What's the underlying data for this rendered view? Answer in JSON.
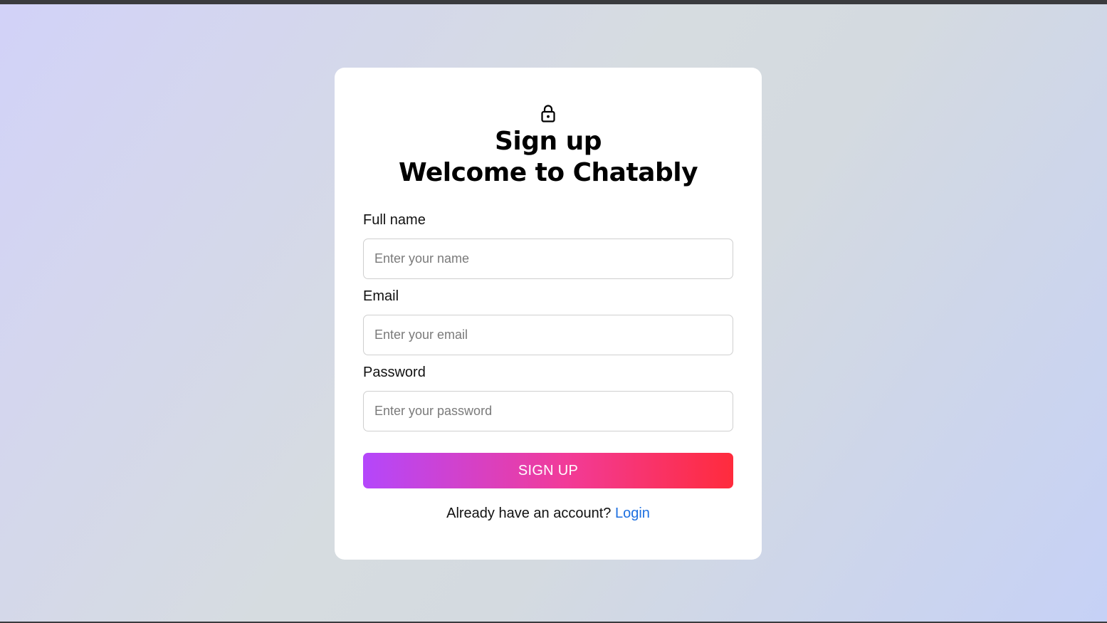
{
  "signup": {
    "icon": "lock-icon",
    "title": "Sign up",
    "subtitle": "Welcome to Chatably",
    "fields": [
      {
        "label": "Full name",
        "placeholder": "Enter your name",
        "value": ""
      },
      {
        "label": "Email",
        "placeholder": "Enter your email",
        "value": ""
      },
      {
        "label": "Password",
        "placeholder": "Enter your password",
        "value": ""
      }
    ],
    "submit_label": "SIGN UP",
    "footer_text": "Already have an account?",
    "login_link": "Login"
  },
  "colors": {
    "button_gradient_start": "#b447fb",
    "button_gradient_mid": "#f23b98",
    "button_gradient_end": "#ff2b3c",
    "link": "#1d6fe0",
    "card": "#ffffff"
  }
}
